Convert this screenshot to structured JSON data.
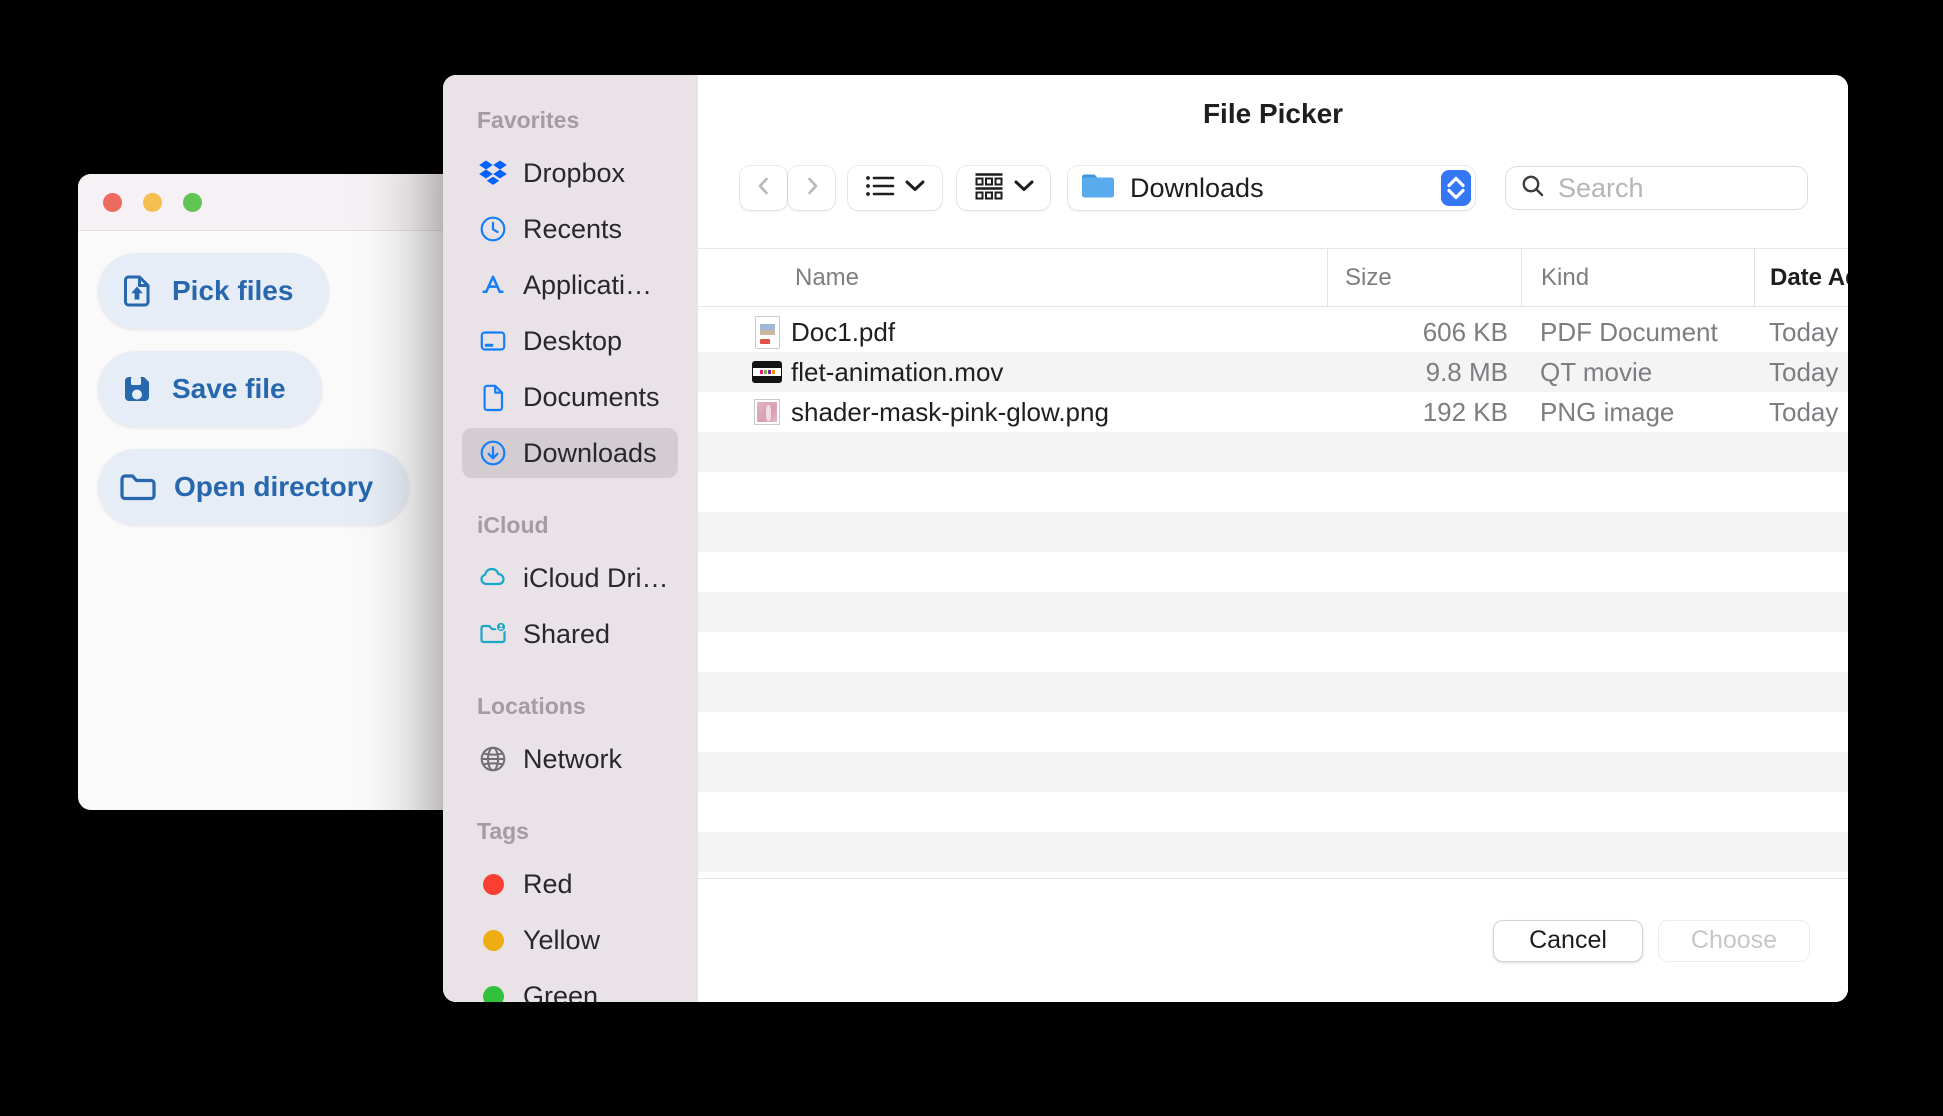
{
  "colors": {
    "accent_blue": "#2667ad",
    "macos_sidebar_icon_blue": "#157efa",
    "dropbox_blue": "#0061fe",
    "icloud_teal": "#1ba8c6",
    "sidebar_selection_gray": "#d3cdd2",
    "path_stepper_blue": "#3478f6",
    "tag_red": "#fa3e34",
    "tag_yellow": "#eead11",
    "tag_green": "#31c13c",
    "traffic_red": "#ec6a5e",
    "traffic_yellow": "#f5bf4f",
    "traffic_green": "#61c554"
  },
  "app_window": {
    "buttons": [
      {
        "label": "Pick files",
        "icon": "file-upload-icon"
      },
      {
        "label": "Save file",
        "icon": "save-icon"
      },
      {
        "label": "Open directory",
        "icon": "open-folder-icon"
      }
    ]
  },
  "dialog": {
    "title": "File Picker",
    "toolbar": {
      "path_location": "Downloads",
      "search_placeholder": "Search"
    },
    "sidebar": {
      "sections": [
        {
          "title": "Favorites",
          "items": [
            {
              "label": "Dropbox",
              "icon": "dropbox-icon"
            },
            {
              "label": "Recents",
              "icon": "clock-icon"
            },
            {
              "label": "Applicati…",
              "icon": "app-store-icon"
            },
            {
              "label": "Desktop",
              "icon": "desktop-icon"
            },
            {
              "label": "Documents",
              "icon": "document-icon"
            },
            {
              "label": "Downloads",
              "icon": "download-circle-icon",
              "selected": true
            }
          ]
        },
        {
          "title": "iCloud",
          "items": [
            {
              "label": "iCloud Dri…",
              "icon": "cloud-icon"
            },
            {
              "label": "Shared",
              "icon": "shared-folder-icon"
            }
          ]
        },
        {
          "title": "Locations",
          "items": [
            {
              "label": "Network",
              "icon": "globe-icon"
            }
          ]
        },
        {
          "title": "Tags",
          "items": [
            {
              "label": "Red",
              "icon": "tag-dot",
              "color": "#fa3e34"
            },
            {
              "label": "Yellow",
              "icon": "tag-dot",
              "color": "#eead11"
            },
            {
              "label": "Green",
              "icon": "tag-dot",
              "color": "#31c13c"
            }
          ]
        }
      ]
    },
    "table": {
      "columns": [
        "Name",
        "Size",
        "Kind",
        "Date Added"
      ],
      "rows": [
        {
          "name": "Doc1.pdf",
          "size": "606 KB",
          "kind": "PDF Document",
          "date_added": "Today",
          "icon": "pdf-file-icon"
        },
        {
          "name": "flet-animation.mov",
          "size": "9.8 MB",
          "kind": "QT movie",
          "date_added": "Today",
          "icon": "mov-file-icon"
        },
        {
          "name": "shader-mask-pink-glow.png",
          "size": "192 KB",
          "kind": "PNG image",
          "date_added": "Today",
          "icon": "png-file-icon"
        }
      ]
    },
    "footer": {
      "cancel_label": "Cancel",
      "choose_label": "Choose"
    }
  }
}
